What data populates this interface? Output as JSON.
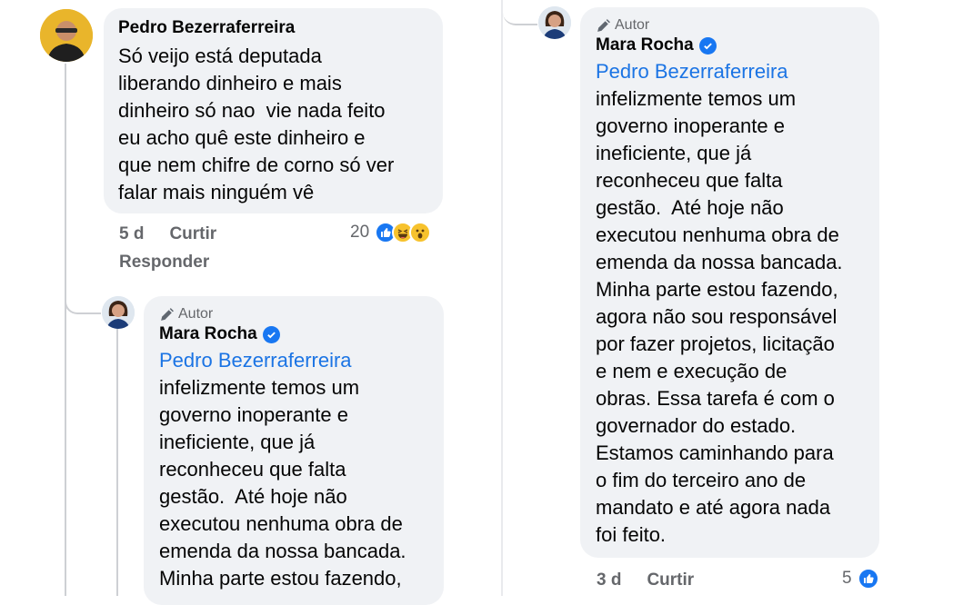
{
  "colors": {
    "bubble": "#f0f2f5",
    "link": "#1b74e4",
    "meta": "#65676b",
    "like": "#1877f2"
  },
  "comments": [
    {
      "author": "Pedro Bezerraferreira",
      "text": "Só veijo está deputada\nliberando dinheiro e mais\ndinheiro só nao  vie nada feito\neu acho quê este dinheiro e\nque nem chifre de corno só ver\nfalar mais ninguém vê",
      "time": "5 d",
      "like_label": "Curtir",
      "reply_label": "Responder",
      "reaction_count": "20",
      "reaction_icons": [
        "like-icon",
        "haha-icon",
        "wow-icon"
      ]
    },
    {
      "badge": "Autor",
      "author": "Mara Rocha",
      "mention": "Pedro Bezerraferreira",
      "text": "infelizmente temos um\ngoverno inoperante e\nineficiente, que já\nreconheceu que falta\ngestão.  Até hoje não\nexecutou nenhuma obra de\nemenda da nossa bancada.\nMinha parte estou fazendo,"
    },
    {
      "badge": "Autor",
      "author": "Mara Rocha",
      "mention": "Pedro Bezerraferreira",
      "text": "infelizmente temos um\ngoverno inoperante e\nineficiente, que já\nreconheceu que falta\ngestão.  Até hoje não\nexecutou nenhuma obra de\nemenda da nossa bancada.\nMinha parte estou fazendo,\nagora não sou responsável\npor fazer projetos, licitação\ne nem e execução de\nobras. Essa tarefa é com o\ngovernador do estado.\nEstamos caminhando para\no fim do terceiro ano de\nmandato e até agora nada\nfoi feito.",
      "time": "3 d",
      "like_label": "Curtir",
      "reaction_count": "5",
      "reaction_icons": [
        "like-icon"
      ]
    }
  ]
}
